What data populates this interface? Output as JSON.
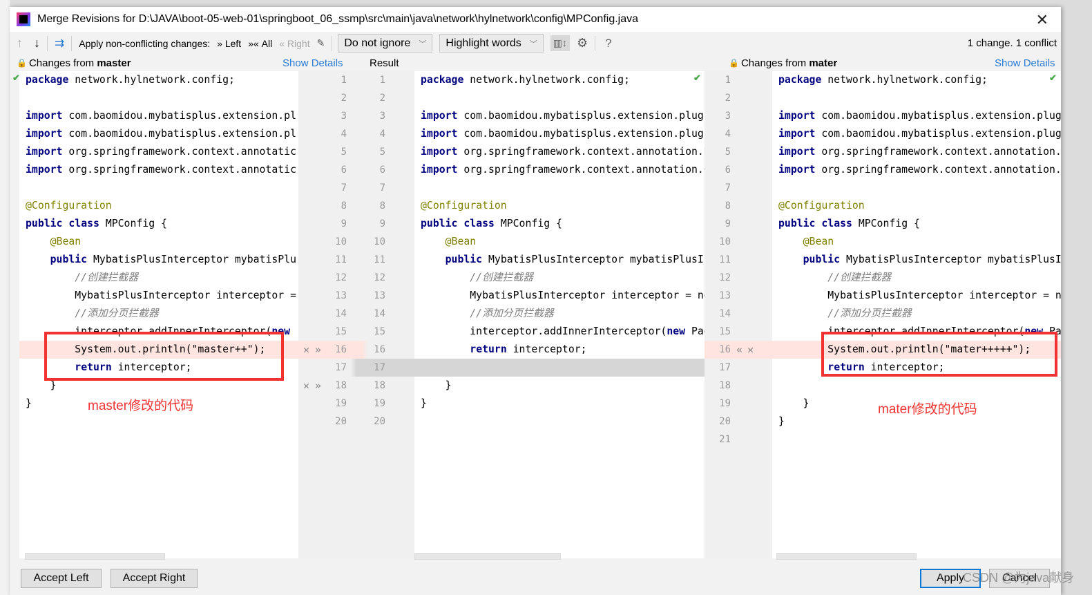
{
  "window": {
    "title": "Merge Revisions for D:\\JAVA\\boot-05-web-01\\springboot_06_ssmp\\src\\main\\java\\network\\hylnetwork\\config\\MPConfig.java",
    "close_icon": "close-icon"
  },
  "toolbar": {
    "apply_label": "Apply non-conflicting changes:",
    "left": "Left",
    "all": "All",
    "right": "Right",
    "ignore": "Do not ignore",
    "highlight": "Highlight words",
    "help": "?",
    "status": "1 change. 1 conflict"
  },
  "left": {
    "header_prefix": "Changes from ",
    "branch": "master",
    "show_details": "Show Details",
    "lines": [
      "package network.hylnetwork.config;",
      "",
      "import com.baomidou.mybatisplus.extension.pl",
      "import com.baomidou.mybatisplus.extension.pl",
      "import org.springframework.context.annotatic",
      "import org.springframework.context.annotatic",
      "",
      "@Configuration",
      "public class MPConfig {",
      "    @Bean",
      "    public MybatisPlusInterceptor mybatisPlu",
      "        //创建拦截器",
      "        MybatisPlusInterceptor interceptor =",
      "        //添加分页拦截器",
      "        interceptor.addInnerInterceptor(new",
      "        System.out.println(\"master++\");",
      "        return interceptor;",
      "    }",
      "}",
      ""
    ]
  },
  "result": {
    "header": "Result",
    "lines": [
      "package network.hylnetwork.config;",
      "",
      "import com.baomidou.mybatisplus.extension.plugi",
      "import com.baomidou.mybatisplus.extension.plugi",
      "import org.springframework.context.annotation.B",
      "import org.springframework.context.annotation.C",
      "",
      "@Configuration",
      "public class MPConfig {",
      "    @Bean",
      "    public MybatisPlusInterceptor mybatisPlusIn",
      "        //创建拦截器",
      "        MybatisPlusInterceptor interceptor = ne",
      "        //添加分页拦截器",
      "        interceptor.addInnerInterceptor(new Pag",
      "        return interceptor;",
      "",
      "    }",
      "}",
      ""
    ]
  },
  "right": {
    "header_prefix": "Changes from ",
    "branch": "mater",
    "show_details": "Show Details",
    "lines": [
      "package network.hylnetwork.config;",
      "",
      "import com.baomidou.mybatisplus.extension.plug",
      "import com.baomidou.mybatisplus.extension.plug",
      "import org.springframework.context.annotation.",
      "import org.springframework.context.annotation.",
      "",
      "@Configuration",
      "public class MPConfig {",
      "    @Bean",
      "    public MybatisPlusInterceptor mybatisPlusI",
      "        //创建拦截器",
      "        MybatisPlusInterceptor interceptor = n",
      "        //添加分页拦截器",
      "        interceptor.addInnerInterceptor(new Pa",
      "        System.out.println(\"mater+++++\");",
      "        return interceptor;",
      "",
      "    }",
      "}",
      ""
    ]
  },
  "annotations": {
    "left_note": "master修改的代码",
    "right_note": "mater修改的代码"
  },
  "buttons": {
    "accept_left": "Accept Left",
    "accept_right": "Accept Right",
    "apply": "Apply",
    "cancel": "Cancel"
  },
  "watermark": "CSDN @为java献身",
  "colors": {
    "conflict": "#ffe4e0",
    "annotation": "#f03232",
    "link": "#2a7bd6",
    "keyword": "#000080"
  }
}
